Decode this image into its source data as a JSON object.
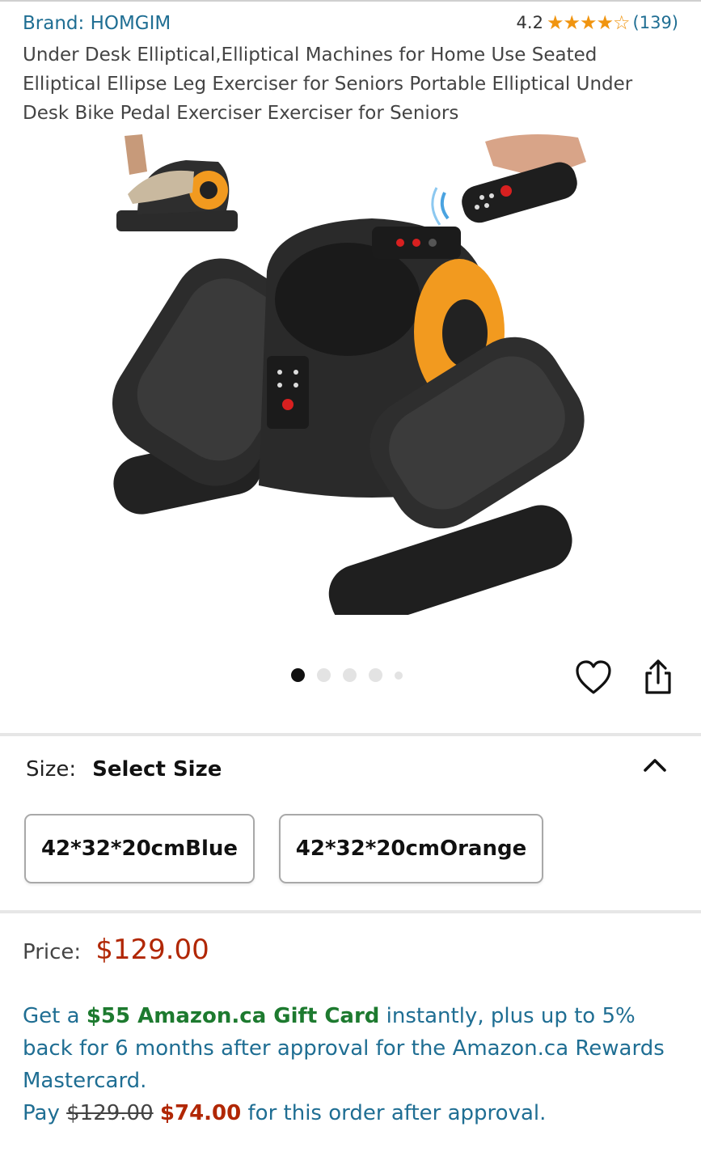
{
  "header": {
    "brand": "Brand: HOMGIM",
    "rating_value": "4.2",
    "rating_stars": "★★★★☆",
    "rating_count": "(139)"
  },
  "product": {
    "title": "Under Desk Elliptical,Elliptical Machines for Home Use Seated Elliptical Ellipse Leg Exerciser for Seniors Portable Elliptical Under Desk Bike Pedal Exerciser Exerciser for Seniors",
    "image_brand_mark": "HOMGIM"
  },
  "carousel": {
    "total_images": 5,
    "active_index": 0
  },
  "icons": {
    "favorite": "heart-icon",
    "share": "share-icon",
    "collapse": "chevron-up-icon"
  },
  "size": {
    "label": "Size:",
    "value": "Select Size",
    "options": [
      "42*32*20cmBlue",
      "42*32*20cmOrange"
    ]
  },
  "price": {
    "label": "Price:",
    "value": "$129.00"
  },
  "promo": {
    "prefix": "Get a ",
    "gift_card": "$55 Amazon.ca Gift Card",
    "middle": " instantly, plus up to 5% back for 6 months after approval for the Amazon.ca Rewards Mastercard.",
    "pay_label": "Pay ",
    "old_price": "$129.00",
    "new_price": "$74.00",
    "suffix": " for this order after approval."
  },
  "colors": {
    "link_blue": "#1f6e93",
    "price_red": "#b12704",
    "promo_green": "#1d7a2f",
    "star_orange": "#f0940f",
    "accent_orange": "#f29a1f"
  }
}
